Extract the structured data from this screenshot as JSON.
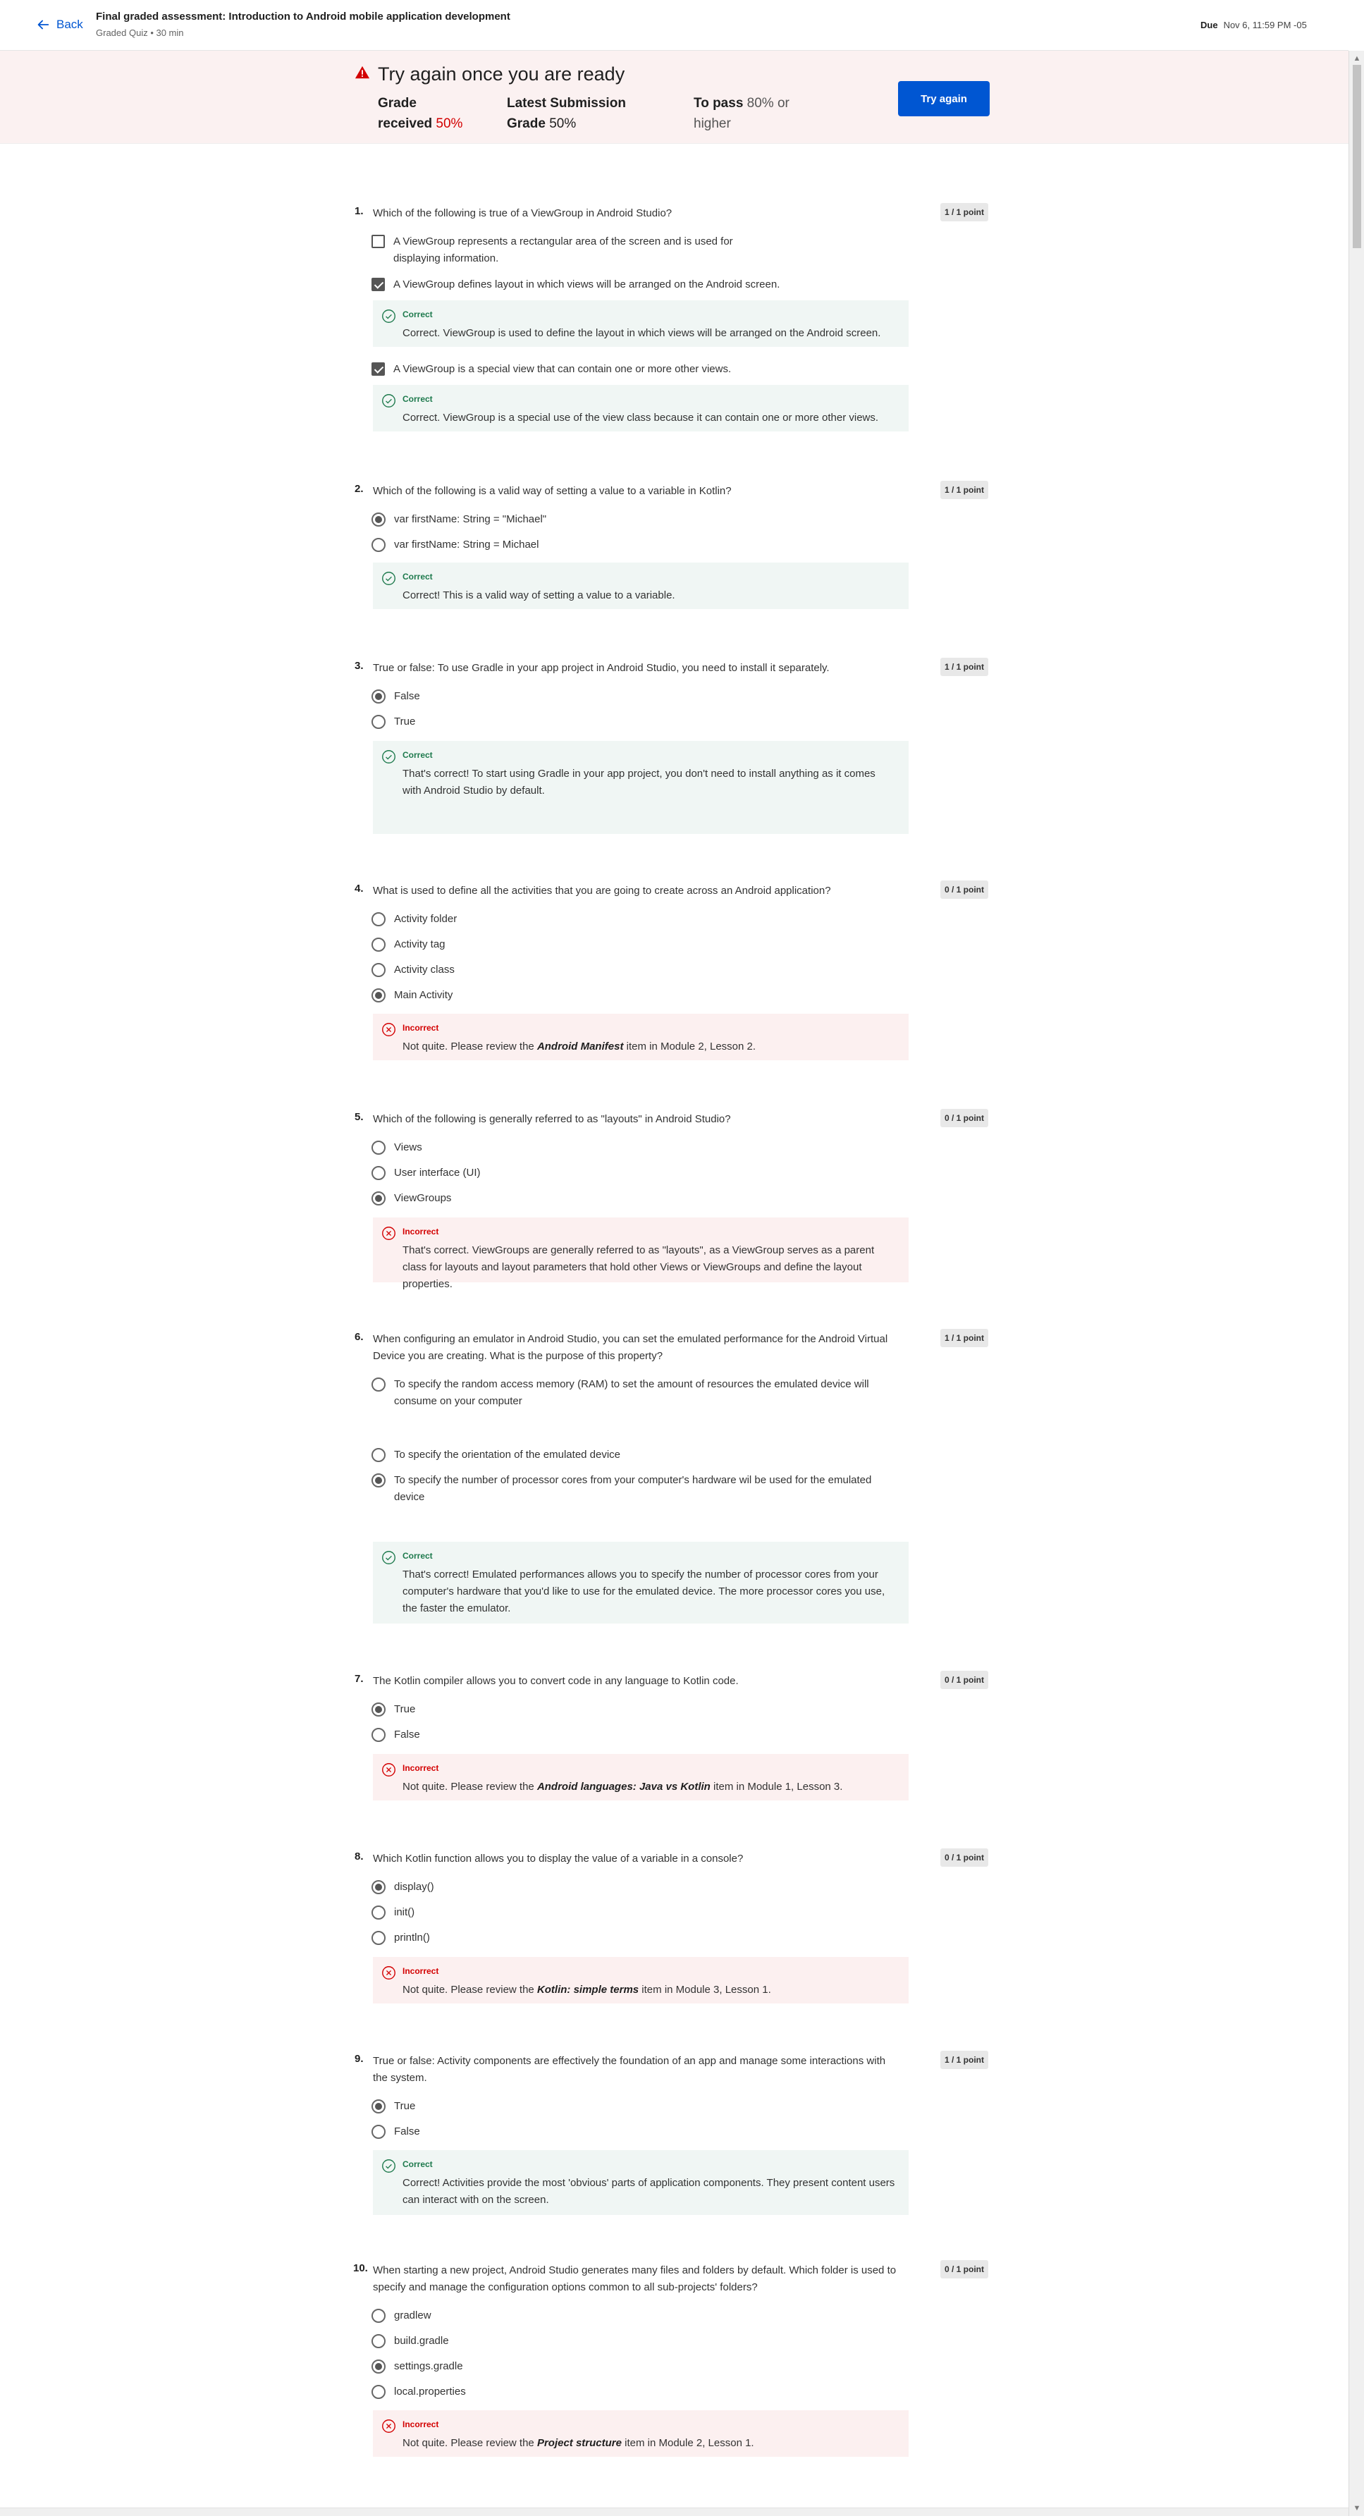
{
  "header": {
    "back_label": "Back",
    "title": "Final graded assessment: Introduction to Android mobile application development",
    "subtitle": "Graded Quiz • 30 min",
    "due_label": "Due",
    "due_value": "Nov 6, 11:59 PM -05"
  },
  "banner": {
    "title": "Try again once you are ready",
    "grade_received_label_1": "Grade",
    "grade_received_label_2": "received",
    "grade_received_value": "50%",
    "latest_label_1": "Latest Submission",
    "latest_label_2": "Grade",
    "latest_value": "50%",
    "to_pass_label": "To pass",
    "to_pass_value": "80% or",
    "to_pass_value_2": "higher",
    "try_again_label": "Try again"
  },
  "questions": [
    {
      "num": "1.",
      "text": "Which of the following is true of a ViewGroup in Android Studio?",
      "points": "1 / 1 point",
      "options": [
        {
          "label": "A ViewGroup represents a rectangular area of the screen and is used for displaying information."
        },
        {
          "label": "A ViewGroup defines layout in which views will be arranged on the Android screen."
        },
        {
          "label": "A ViewGroup is a special view that can contain one or more other views."
        }
      ],
      "feedback": [
        {
          "head": "Correct",
          "body": "Correct. ViewGroup is used to define the layout in which views will be arranged on the Android screen."
        },
        {
          "head": "Correct",
          "body": "Correct. ViewGroup is a special use of the view class because it can contain one or more other views."
        }
      ]
    },
    {
      "num": "2.",
      "text": "Which of the following is a valid way of setting a value to a variable in Kotlin?",
      "points": "1 / 1 point",
      "options": [
        {
          "label": "var firstName: String = \"Michael\""
        },
        {
          "label": "var firstName: String = Michael"
        }
      ],
      "feedback": [
        {
          "head": "Correct",
          "body": "Correct! This is a valid way of setting a value to a variable."
        }
      ]
    },
    {
      "num": "3.",
      "text": "True or false: To use Gradle in your app project in Android Studio, you need to install it separately.",
      "points": "1 / 1 point",
      "options": [
        {
          "label": "False"
        },
        {
          "label": "True"
        }
      ],
      "feedback": [
        {
          "head": "Correct",
          "body": "That's correct! To start using Gradle in your app project, you don't need to install anything as it comes with Android Studio by default."
        }
      ]
    },
    {
      "num": "4.",
      "text": "What is used to define all the activities that you are going to create across an Android application?",
      "points": "0 / 1 point",
      "options": [
        {
          "label": "Activity folder"
        },
        {
          "label": "Activity tag"
        },
        {
          "label": "Activity class"
        },
        {
          "label": "Main Activity"
        }
      ],
      "feedback": [
        {
          "head": "Incorrect",
          "body_pre": "Not quite. Please review the ",
          "body_em": "Android Manifest",
          "body_post": " item in Module 2, Lesson 2."
        }
      ]
    },
    {
      "num": "5.",
      "text": "Which of the following is generally referred to as \"layouts\" in Android Studio?",
      "points": "0 / 1 point",
      "options": [
        {
          "label": "Views"
        },
        {
          "label": "User interface (UI)"
        },
        {
          "label": "ViewGroups"
        }
      ],
      "feedback": [
        {
          "head": "Incorrect",
          "body": "That's correct. ViewGroups are generally referred to as \"layouts\", as a ViewGroup serves as a parent class for layouts and layout parameters that hold other Views or ViewGroups and define the layout properties."
        }
      ]
    },
    {
      "num": "6.",
      "text": "When configuring an emulator in Android Studio, you can set the emulated performance for the Android Virtual Device you are creating. What is the purpose of this property?",
      "points": "1 / 1 point",
      "options": [
        {
          "label": "To specify the random access memory (RAM) to set the amount of resources the emulated device will consume on your computer"
        },
        {
          "label": "To specify the orientation of the emulated device"
        },
        {
          "label": "To specify the number of processor cores from your computer's hardware wil be used for the emulated device"
        }
      ],
      "feedback": [
        {
          "head": "Correct",
          "body": "That's correct! Emulated performances allows you to specify the number of processor cores from your computer's hardware that you'd like to use for the emulated device. The more processor cores you use, the faster the emulator."
        }
      ]
    },
    {
      "num": "7.",
      "text": "The Kotlin compiler allows you to convert code in any language to Kotlin code.",
      "points": "0 / 1 point",
      "options": [
        {
          "label": "True"
        },
        {
          "label": "False"
        }
      ],
      "feedback": [
        {
          "head": "Incorrect",
          "body_pre": "Not quite. Please review the ",
          "body_em": "Android languages: Java vs Kotlin",
          "body_post": " item in Module 1, Lesson 3."
        }
      ]
    },
    {
      "num": "8.",
      "text": "Which Kotlin function allows you to display the value of a variable in a console?",
      "points": "0 / 1 point",
      "options": [
        {
          "label": "display()"
        },
        {
          "label": "init()"
        },
        {
          "label": "println()"
        }
      ],
      "feedback": [
        {
          "head": "Incorrect",
          "body_pre": "Not quite. Please review the ",
          "body_em": "Kotlin: simple terms",
          "body_post": " item in Module 3, Lesson 1."
        }
      ]
    },
    {
      "num": "9.",
      "text": "True or false: Activity components are effectively the foundation of an app and manage some interactions with the system.",
      "points": "1 / 1 point",
      "options": [
        {
          "label": "True"
        },
        {
          "label": "False"
        }
      ],
      "feedback": [
        {
          "head": "Correct",
          "body": "Correct! Activities provide the most 'obvious' parts of application components. They present content users can interact with on the screen."
        }
      ]
    },
    {
      "num": "10.",
      "text": "When starting a new project, Android Studio generates many files and folders by default. Which folder is used to specify and manage the configuration options common to all sub-projects' folders?",
      "points": "0 / 1 point",
      "options": [
        {
          "label": "gradlew"
        },
        {
          "label": "build.gradle"
        },
        {
          "label": "settings.gradle"
        },
        {
          "label": "local.properties"
        }
      ],
      "feedback": [
        {
          "head": "Incorrect",
          "body_pre": "Not quite. Please review the ",
          "body_em": "Project structure",
          "body_post": " item in Module 2, Lesson 1."
        }
      ]
    }
  ],
  "colors": {
    "accent": "#0056d2",
    "error": "#d30001",
    "success": "#1e7a4d",
    "banner_bg": "#fbf1f1"
  },
  "icons": {
    "back": "arrow-left-icon",
    "warning": "warning-triangle-icon",
    "correct": "check-circle-icon",
    "incorrect": "x-circle-icon"
  }
}
